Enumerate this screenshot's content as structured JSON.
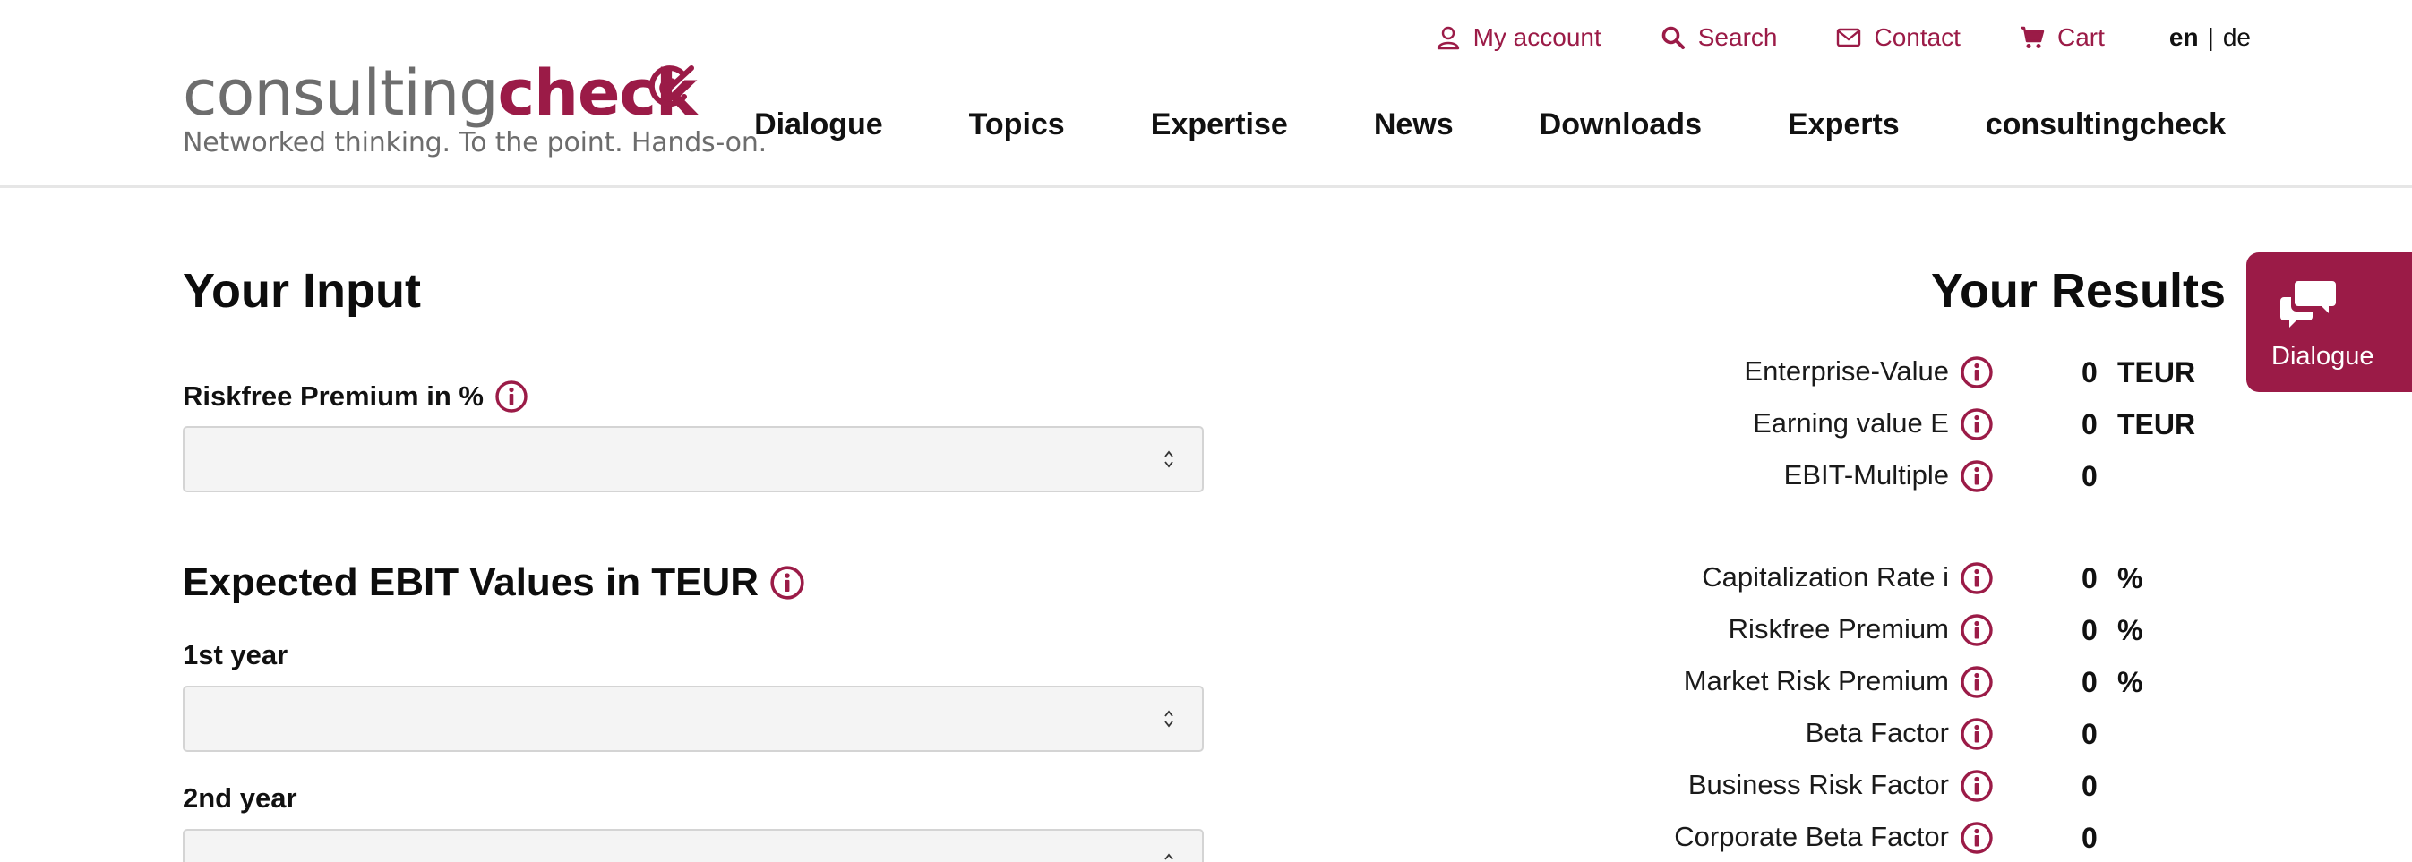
{
  "brand": {
    "name_part1": "consulting",
    "name_part2": "check",
    "tagline": "Networked thinking. To the point. Hands-on.",
    "accent_color": "#9b1b47"
  },
  "utility_nav": {
    "items": [
      {
        "label": "My account",
        "icon": "user-icon"
      },
      {
        "label": "Search",
        "icon": "search-icon"
      },
      {
        "label": "Contact",
        "icon": "envelope-icon"
      },
      {
        "label": "Cart",
        "icon": "cart-icon"
      }
    ],
    "lang_active": "en",
    "lang_separator": "|",
    "lang_other": "de"
  },
  "main_nav": {
    "items": [
      "Dialogue",
      "Topics",
      "Expertise",
      "News",
      "Downloads",
      "Experts",
      "consultingcheck"
    ]
  },
  "input": {
    "title": "Your Input",
    "riskfree_label": "Riskfree Premium in %",
    "riskfree_value": "",
    "ebit_title": "Expected EBIT Values in TEUR",
    "year1_label": "1st year",
    "year1_value": "",
    "year2_label": "2nd year",
    "year2_value": ""
  },
  "results": {
    "title": "Your Results",
    "rows": [
      {
        "label": "Enterprise-Value",
        "value": "0",
        "unit": "TEUR"
      },
      {
        "label": "Earning value E",
        "value": "0",
        "unit": "TEUR"
      },
      {
        "label": "EBIT-Multiple",
        "value": "0",
        "unit": ""
      },
      {
        "label": "Capitalization Rate i",
        "value": "0",
        "unit": "%"
      },
      {
        "label": "Riskfree Premium",
        "value": "0",
        "unit": "%"
      },
      {
        "label": "Market Risk Premium",
        "value": "0",
        "unit": "%"
      },
      {
        "label": "Beta Factor",
        "value": "0",
        "unit": ""
      },
      {
        "label": "Business Risk Factor",
        "value": "0",
        "unit": ""
      },
      {
        "label": "Corporate Beta Factor",
        "value": "0",
        "unit": ""
      }
    ]
  },
  "dialogue_tab": {
    "label": "Dialogue",
    "icon": "chat-bubbles-icon"
  }
}
